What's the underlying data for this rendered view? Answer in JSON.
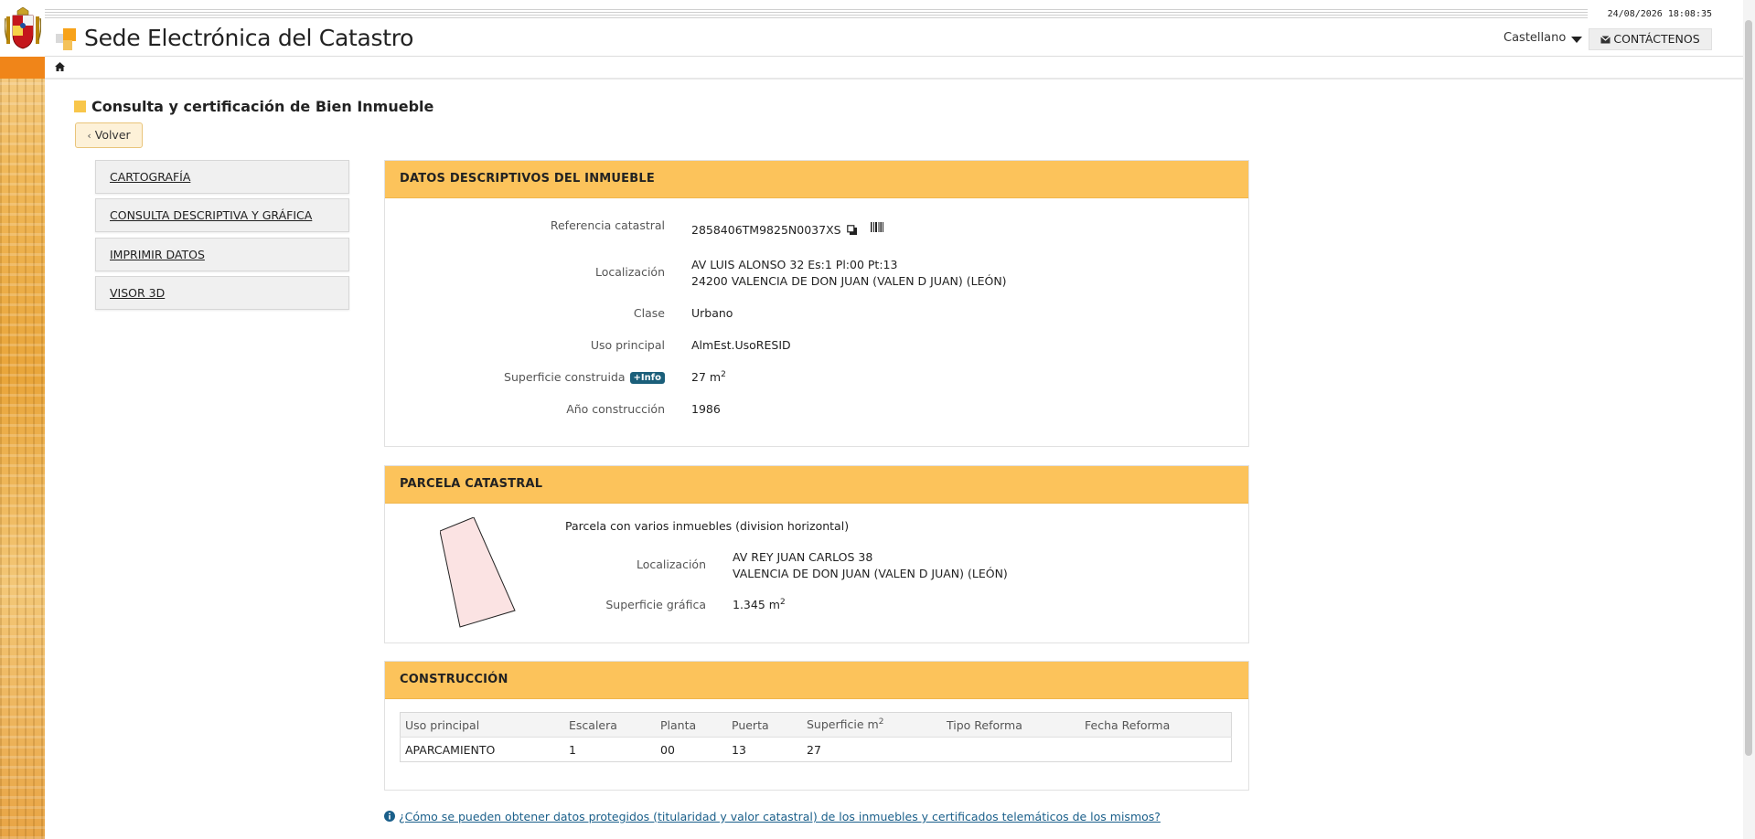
{
  "header": {
    "datetime": "24/08/2026  18:08:35",
    "site_title": "Sede Electrónica del Catastro",
    "language": "Castellano",
    "contact_label": "CONTÁCTENOS"
  },
  "page": {
    "title": "Consulta y certificación de Bien Inmueble",
    "back_label": "Volver"
  },
  "side_menu": [
    {
      "label": "CARTOGRAFÍA"
    },
    {
      "label": "CONSULTA DESCRIPTIVA Y GRÁFICA"
    },
    {
      "label": "IMPRIMIR DATOS"
    },
    {
      "label": "VISOR 3D"
    }
  ],
  "descriptivos": {
    "header": "DATOS DESCRIPTIVOS DEL INMUEBLE",
    "referencia_label": "Referencia catastral",
    "referencia_value": "2858406TM9825N0037XS",
    "localizacion_label": "Localización",
    "localizacion_line1": "AV LUIS ALONSO 32 Es:1 Pl:00 Pt:13",
    "localizacion_line2": "24200 VALENCIA DE DON JUAN (VALEN D JUAN) (LEÓN)",
    "clase_label": "Clase",
    "clase_value": "Urbano",
    "uso_label": "Uso principal",
    "uso_value": "AlmEst.UsoRESID",
    "superficie_label": "Superficie construida",
    "info_badge": "+Info",
    "superficie_value": "27 m",
    "superficie_unit_sup": "2",
    "anio_label": "Año construcción",
    "anio_value": "1986"
  },
  "parcela": {
    "header": "PARCELA CATASTRAL",
    "description": "Parcela con varios inmuebles (division horizontal)",
    "localizacion_label": "Localización",
    "localizacion_line1": "AV REY JUAN CARLOS 38",
    "localizacion_line2": "VALENCIA DE DON JUAN (VALEN D JUAN) (LEÓN)",
    "superficie_label": "Superficie gráfica",
    "superficie_value": "1.345 m",
    "superficie_unit_sup": "2",
    "parcel_fill": "#fbe3e3"
  },
  "construccion": {
    "header": "CONSTRUCCIÓN",
    "columns": [
      "Uso principal",
      "Escalera",
      "Planta",
      "Puerta",
      "Superficie m",
      "Tipo Reforma",
      "Fecha Reforma"
    ],
    "superficie_sup": "2",
    "rows": [
      [
        "APARCAMIENTO",
        "1",
        "00",
        "13",
        "27",
        "",
        ""
      ]
    ]
  },
  "help_link": "¿Cómo se pueden obtener datos protegidos (titularidad y valor catastral) de los inmuebles y certificados telemáticos de los mismos?",
  "colors": {
    "accent_orange": "#f08519",
    "panel_header": "#fcc35b",
    "link": "#1a5f8a"
  }
}
